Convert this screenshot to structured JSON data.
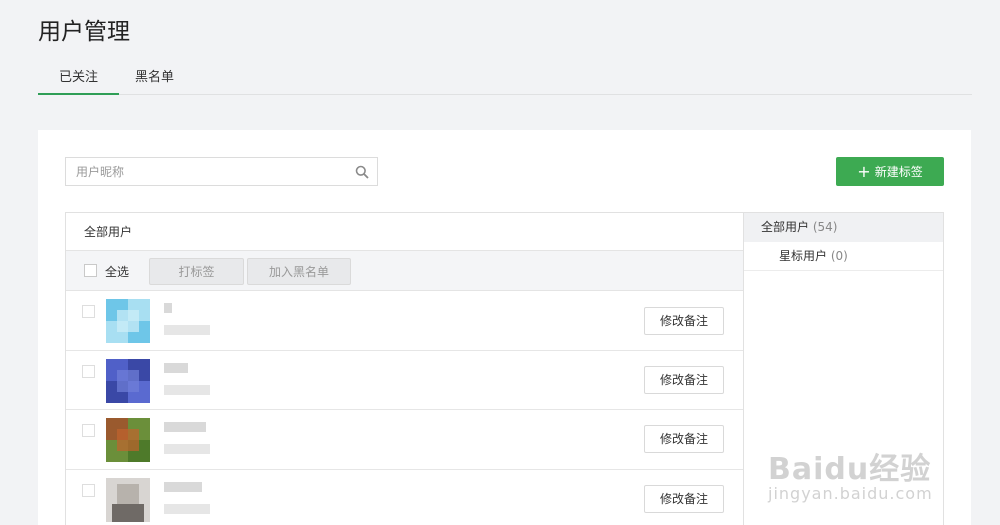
{
  "page": {
    "title": "用户管理"
  },
  "tabs": [
    {
      "label": "已关注"
    },
    {
      "label": "黑名单"
    }
  ],
  "search": {
    "placeholder": "用户昵称"
  },
  "new_tag_button": {
    "label": "新建标签"
  },
  "user_list": {
    "header": "全部用户",
    "select_all_label": "全选",
    "tag_button": "打标签",
    "blacklist_button": "加入黑名单",
    "edit_remark_label": "修改备注",
    "rows": [
      {
        "avatar_colors": [
          "#6ec6e8",
          "#a8dff2"
        ]
      },
      {
        "avatar_colors": [
          "#5060c8",
          "#3a48a6"
        ]
      },
      {
        "avatar_colors": [
          "#6b8f3a",
          "#9a5a2e"
        ]
      },
      {
        "avatar_colors": [
          "#b7b2ac",
          "#6f6a66"
        ]
      }
    ]
  },
  "tag_sidebar": {
    "all_label": "全部用户",
    "all_count": "(54)",
    "star_label": "星标用户",
    "star_count": "(0)"
  },
  "watermark": {
    "main": "Baidu经验",
    "sub": "jingyan.baidu.com"
  },
  "colors": {
    "accent": "#3daa52",
    "active_tab_underline": "#2f9e56"
  }
}
